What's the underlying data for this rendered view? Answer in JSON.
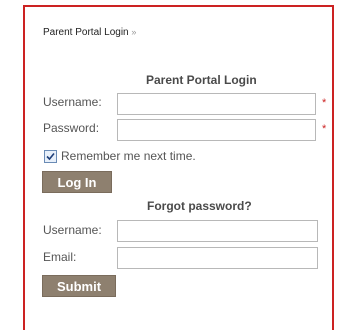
{
  "breadcrumb": {
    "label": "Parent Portal Login",
    "separator": "»"
  },
  "login": {
    "heading": "Parent Portal Login",
    "username_label": "Username:",
    "username_value": "",
    "password_label": "Password:",
    "password_value": "",
    "required_mark": "*",
    "remember_label": "Remember me next time.",
    "remember_checked": true,
    "submit_label": "Log In"
  },
  "forgot": {
    "heading": "Forgot password?",
    "username_label": "Username:",
    "username_value": "",
    "email_label": "Email:",
    "email_value": "",
    "submit_label": "Submit"
  },
  "colors": {
    "frame_border": "#cc2222",
    "button_bg": "#8e806f",
    "required_mark": "#cc2222"
  }
}
